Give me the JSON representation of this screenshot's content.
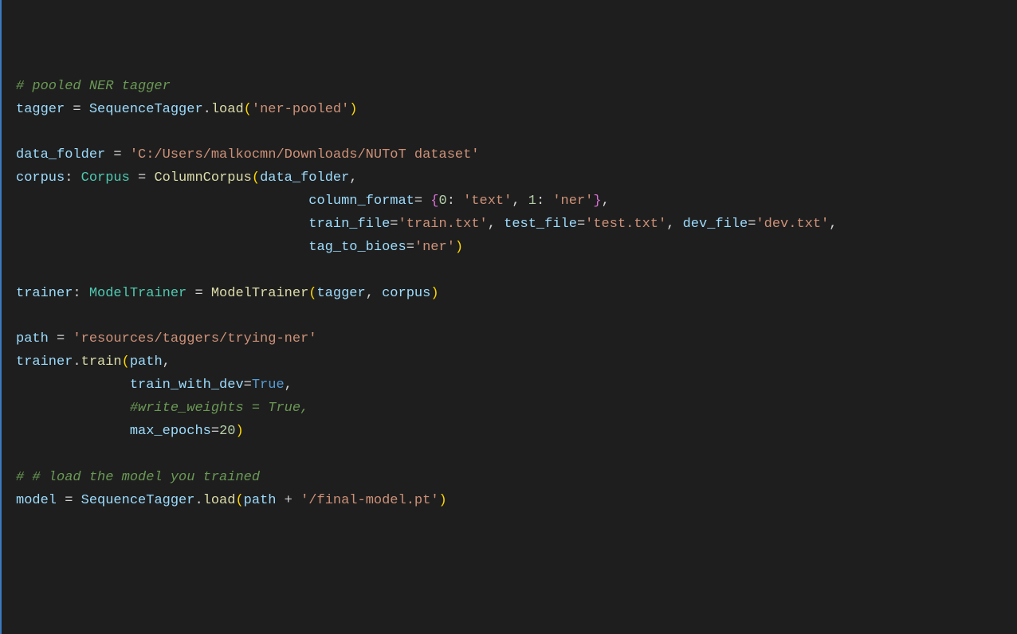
{
  "code": {
    "l1_comment": "# pooled NER tagger",
    "l2_tagger": "tagger",
    "l2_eq": " = ",
    "l2_class": "SequenceTagger",
    "l2_dot": ".",
    "l2_method": "load",
    "l2_arg": "'ner-pooled'",
    "l4_var": "data_folder",
    "l4_eq": " = ",
    "l4_str": "'C:/Users/malkocmn/Downloads/NUToT dataset'",
    "l5_var": "corpus",
    "l5_colon": ": ",
    "l5_type": "Corpus",
    "l5_eq": " = ",
    "l5_class": "ColumnCorpus",
    "l5_arg": "data_folder",
    "l6_indent": "                                    ",
    "l6_kw": "column_format",
    "l6_eq": "= ",
    "l6_k0": "0",
    "l6_v0": "'text'",
    "l6_k1": "1",
    "l6_v1": "'ner'",
    "l7_indent": "                                    ",
    "l7_kw1": "train_file",
    "l7_v1": "'train.txt'",
    "l7_kw2": "test_file",
    "l7_v2": "'test.txt'",
    "l7_kw3": "dev_file",
    "l7_v3": "'dev.txt'",
    "l8_indent": "                                    ",
    "l8_kw": "tag_to_bioes",
    "l8_v": "'ner'",
    "l10_var": "trainer",
    "l10_colon": ": ",
    "l10_type": "ModelTrainer",
    "l10_eq": " = ",
    "l10_class": "ModelTrainer",
    "l10_a1": "tagger",
    "l10_a2": "corpus",
    "l12_var": "path",
    "l12_eq": " = ",
    "l12_str": "'resources/taggers/trying-ner'",
    "l13_var": "trainer",
    "l13_dot": ".",
    "l13_method": "train",
    "l13_arg": "path",
    "l14_indent": "              ",
    "l14_kw": "train_with_dev",
    "l14_v": "True",
    "l15_indent": "              ",
    "l15_comment": "#write_weights = True,",
    "l16_indent": "              ",
    "l16_kw": "max_epochs",
    "l16_v": "20",
    "l18_comment": "# # load the model you trained",
    "l19_var": "model",
    "l19_eq": " = ",
    "l19_class": "SequenceTagger",
    "l19_dot": ".",
    "l19_method": "load",
    "l19_a1": "path",
    "l19_plus": " + ",
    "l19_a2": "'/final-model.pt'"
  }
}
